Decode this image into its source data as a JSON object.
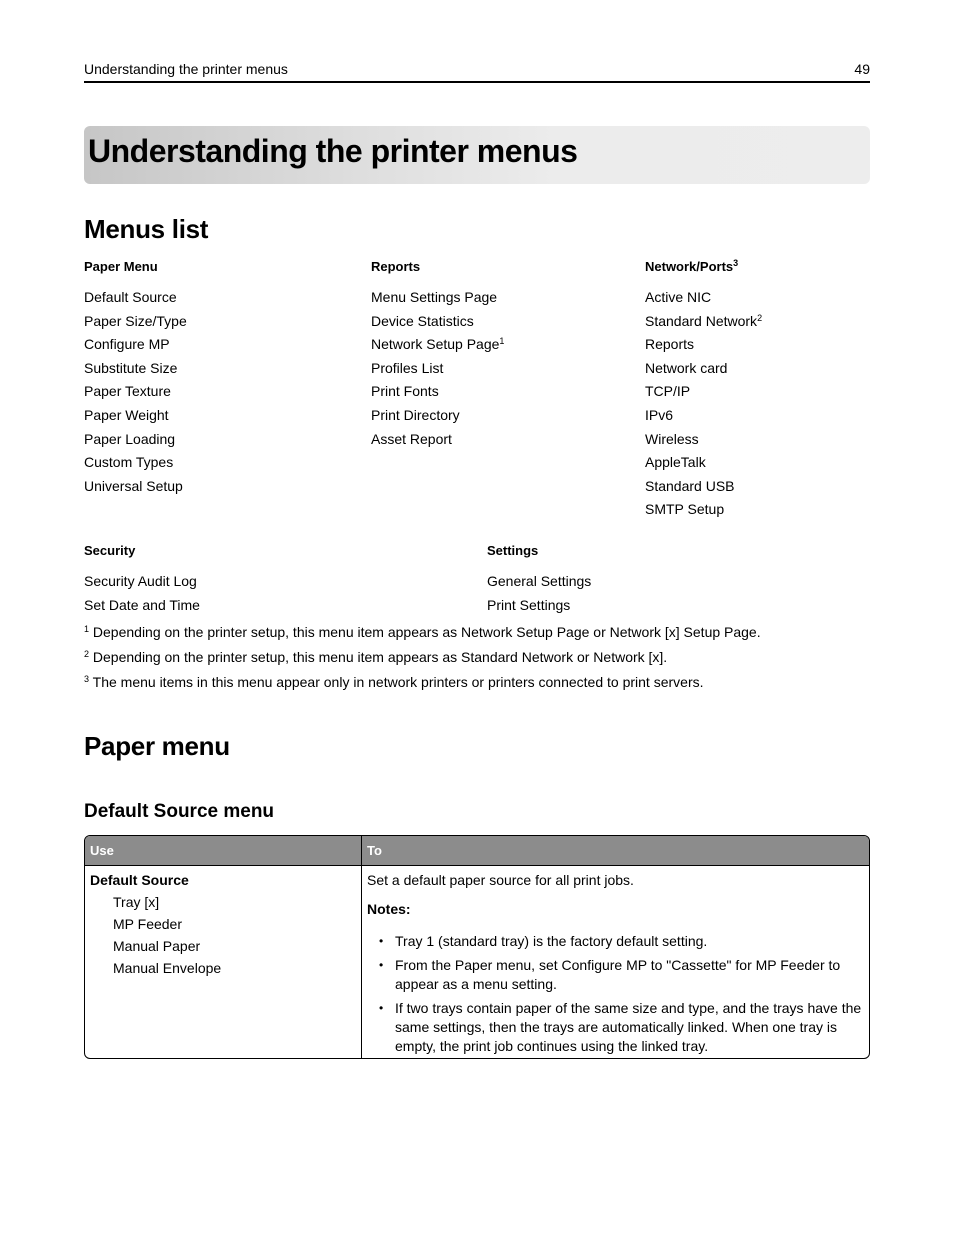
{
  "header": {
    "running_title": "Understanding the printer menus",
    "page_number": "49"
  },
  "chapter": {
    "title": "Understanding the printer menus"
  },
  "menus_list": {
    "heading": "Menus list",
    "columns": [
      {
        "title": "Paper Menu",
        "title_sup": "",
        "items": [
          {
            "label": "Default Source",
            "sup": ""
          },
          {
            "label": "Paper Size/Type",
            "sup": ""
          },
          {
            "label": "Configure MP",
            "sup": ""
          },
          {
            "label": "Substitute Size",
            "sup": ""
          },
          {
            "label": "Paper Texture",
            "sup": ""
          },
          {
            "label": "Paper Weight",
            "sup": ""
          },
          {
            "label": "Paper Loading",
            "sup": ""
          },
          {
            "label": "Custom Types",
            "sup": ""
          },
          {
            "label": "Universal Setup",
            "sup": ""
          }
        ]
      },
      {
        "title": "Reports",
        "title_sup": "",
        "items": [
          {
            "label": "Menu Settings Page",
            "sup": ""
          },
          {
            "label": "Device Statistics",
            "sup": ""
          },
          {
            "label": "Network Setup Page",
            "sup": "1"
          },
          {
            "label": "Profiles List",
            "sup": ""
          },
          {
            "label": "Print Fonts",
            "sup": ""
          },
          {
            "label": "Print Directory",
            "sup": ""
          },
          {
            "label": "Asset Report",
            "sup": ""
          }
        ]
      },
      {
        "title": "Network/Ports",
        "title_sup": "3",
        "items": [
          {
            "label": "Active NIC",
            "sup": ""
          },
          {
            "label": "Standard Network",
            "sup": "2"
          },
          {
            "label": "Reports",
            "sup": ""
          },
          {
            "label": "Network card",
            "sup": ""
          },
          {
            "label": "TCP/IP",
            "sup": ""
          },
          {
            "label": "IPv6",
            "sup": ""
          },
          {
            "label": "Wireless",
            "sup": ""
          },
          {
            "label": "AppleTalk",
            "sup": ""
          },
          {
            "label": "Standard USB",
            "sup": ""
          },
          {
            "label": "SMTP Setup",
            "sup": ""
          }
        ]
      },
      {
        "title": "Security",
        "title_sup": "",
        "items": [
          {
            "label": "Security Audit Log",
            "sup": ""
          },
          {
            "label": "Set Date and Time",
            "sup": ""
          }
        ]
      },
      {
        "title": "Settings",
        "title_sup": "",
        "items": [
          {
            "label": "General Settings",
            "sup": ""
          },
          {
            "label": "Print Settings",
            "sup": ""
          }
        ]
      }
    ],
    "footnotes": [
      {
        "mark": "1",
        "text": " Depending on the printer setup, this menu item appears as Network Setup Page or Network [x] Setup Page."
      },
      {
        "mark": "2",
        "text": " Depending on the printer setup, this menu item appears as Standard Network or Network [x]."
      },
      {
        "mark": "3",
        "text": " The menu items in this menu appear only in network printers or printers connected to print servers."
      }
    ]
  },
  "paper_menu": {
    "heading": "Paper menu",
    "default_source": {
      "heading": "Default Source menu",
      "table": {
        "col_use": "Use",
        "col_to": "To",
        "use_title": "Default Source",
        "use_options": [
          "Tray [x]",
          "MP Feeder",
          "Manual Paper",
          "Manual Envelope"
        ],
        "to_description": "Set a default paper source for all print jobs.",
        "notes_label": "Notes:",
        "notes": [
          "Tray 1 (standard tray) is the factory default setting.",
          "From the Paper menu, set Configure MP to \"Cassette\" for MP Feeder to appear as a menu setting.",
          "If two trays contain paper of the same size and type, and the trays have the same settings, then the trays are automatically linked. When one tray is empty, the print job continues using the linked tray."
        ],
        "bullet_glyph": "•"
      }
    }
  }
}
